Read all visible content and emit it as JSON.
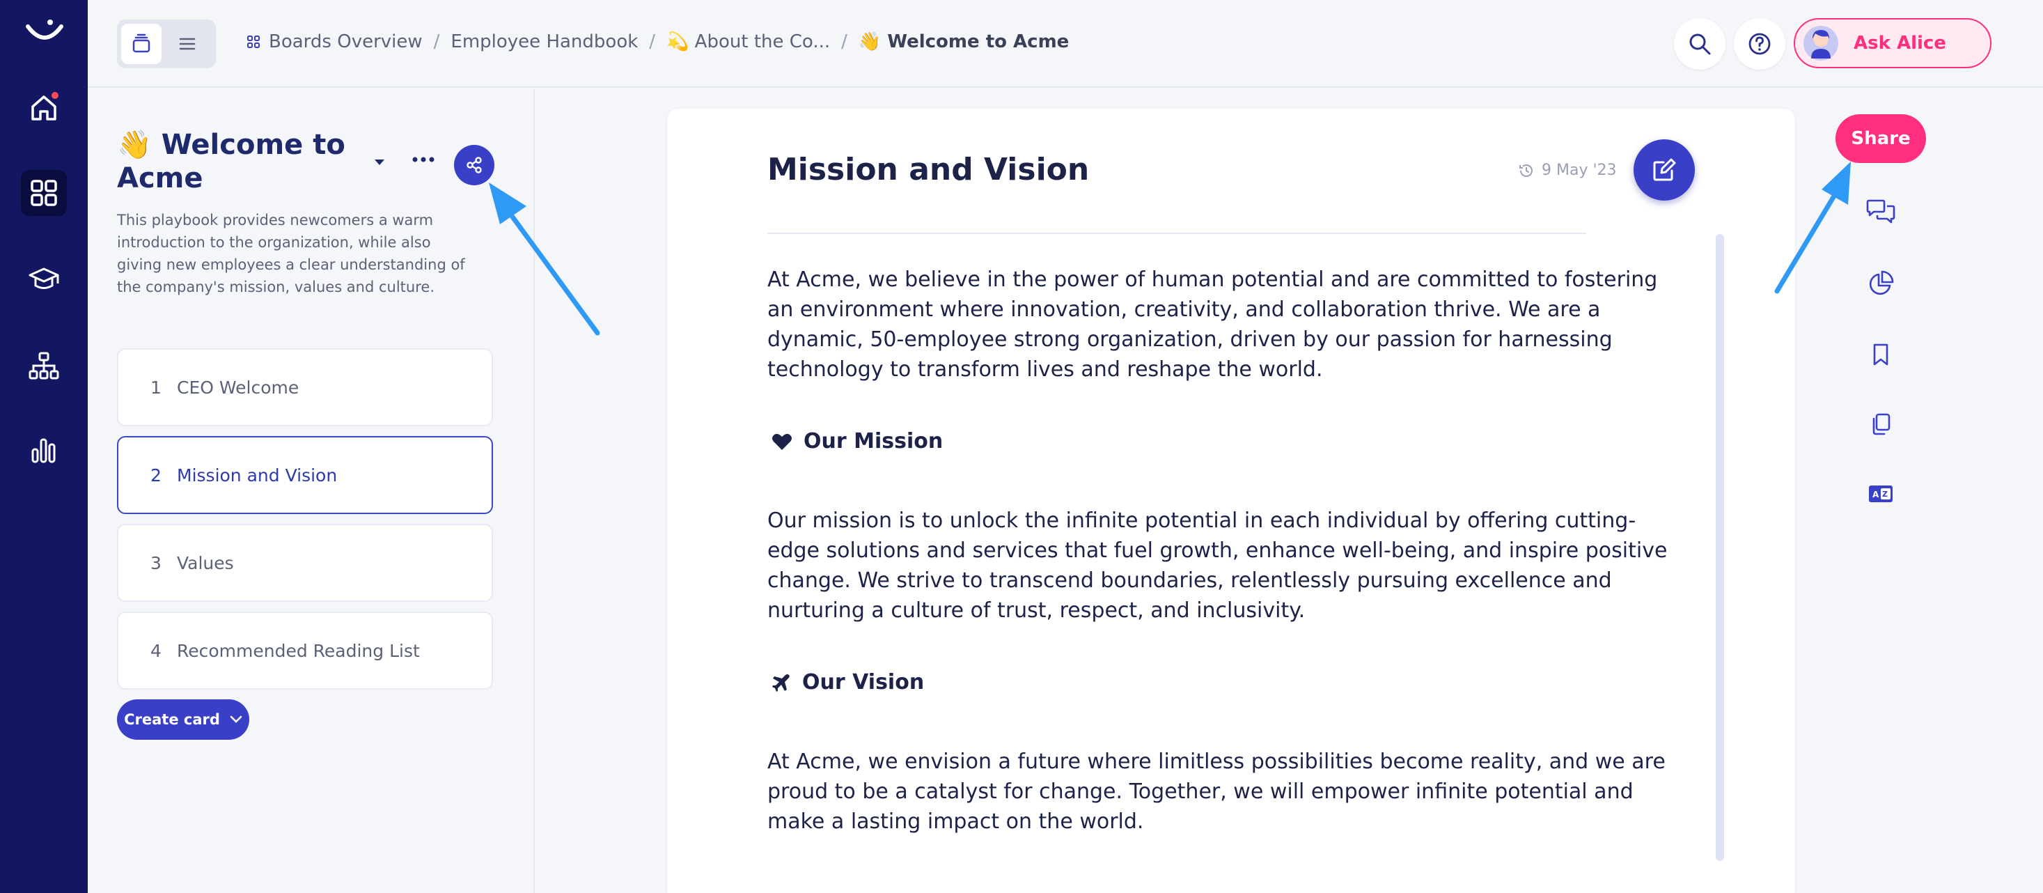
{
  "colors": {
    "navy": "#131660",
    "accent_blue": "#3a3fc8",
    "accent_pink": "#ff2e7e",
    "annotation_arrow": "#2f9af5"
  },
  "topbar": {
    "breadcrumb": {
      "boards": "Boards Overview",
      "handbook": "Employee Handbook",
      "about": "💫 About the Co...",
      "current": "👋 Welcome to Acme",
      "separator": "/"
    },
    "ask_alice_label": "Ask Alice",
    "icons": [
      "search-icon",
      "help-icon",
      "plus-icon"
    ]
  },
  "rail": {
    "icons": [
      "logo-icon",
      "home-icon",
      "grid-icon",
      "graduation-cap-icon",
      "org-chart-icon",
      "bar-chart-icon"
    ]
  },
  "playbook": {
    "title": "👋 Welcome to Acme",
    "description": "This playbook provides newcomers a warm introduction to the organization, while also giving new employees a clear understanding of the company's mission, values and culture.",
    "cards": [
      {
        "num": "1",
        "label": "CEO Welcome"
      },
      {
        "num": "2",
        "label": "Mission and Vision"
      },
      {
        "num": "3",
        "label": "Values"
      },
      {
        "num": "4",
        "label": "Recommended Reading List"
      }
    ],
    "active_card": "2",
    "create_card_label": "Create card"
  },
  "document": {
    "title": "Mission and Vision",
    "date": "9 May '23",
    "intro": "At Acme, we believe in the power of human potential and are committed to fostering an environment where innovation, creativity, and collaboration thrive. We are a dynamic, 50-employee strong organization, driven by our passion for harnessing technology to transform lives and reshape the world.",
    "mission_heading": "Our Mission",
    "mission_text": "Our mission is to unlock the infinite potential in each individual by offering cutting-edge solutions and services that fuel growth, enhance well-being, and inspire positive change. We strive to transcend boundaries, relentlessly pursuing excellence and nurturing a culture of trust, respect, and inclusivity.",
    "vision_heading": "Our Vision",
    "vision_text": "At Acme, we envision a future where limitless possibilities become reality, and we are proud to be a catalyst for change. Together, we will empower infinite potential and make a lasting impact on the world."
  },
  "right_rail": {
    "share_label": "Share",
    "icons": [
      "comments-icon",
      "pie-chart-icon",
      "bookmark-icon",
      "copy-icon",
      "translate-icon"
    ]
  }
}
